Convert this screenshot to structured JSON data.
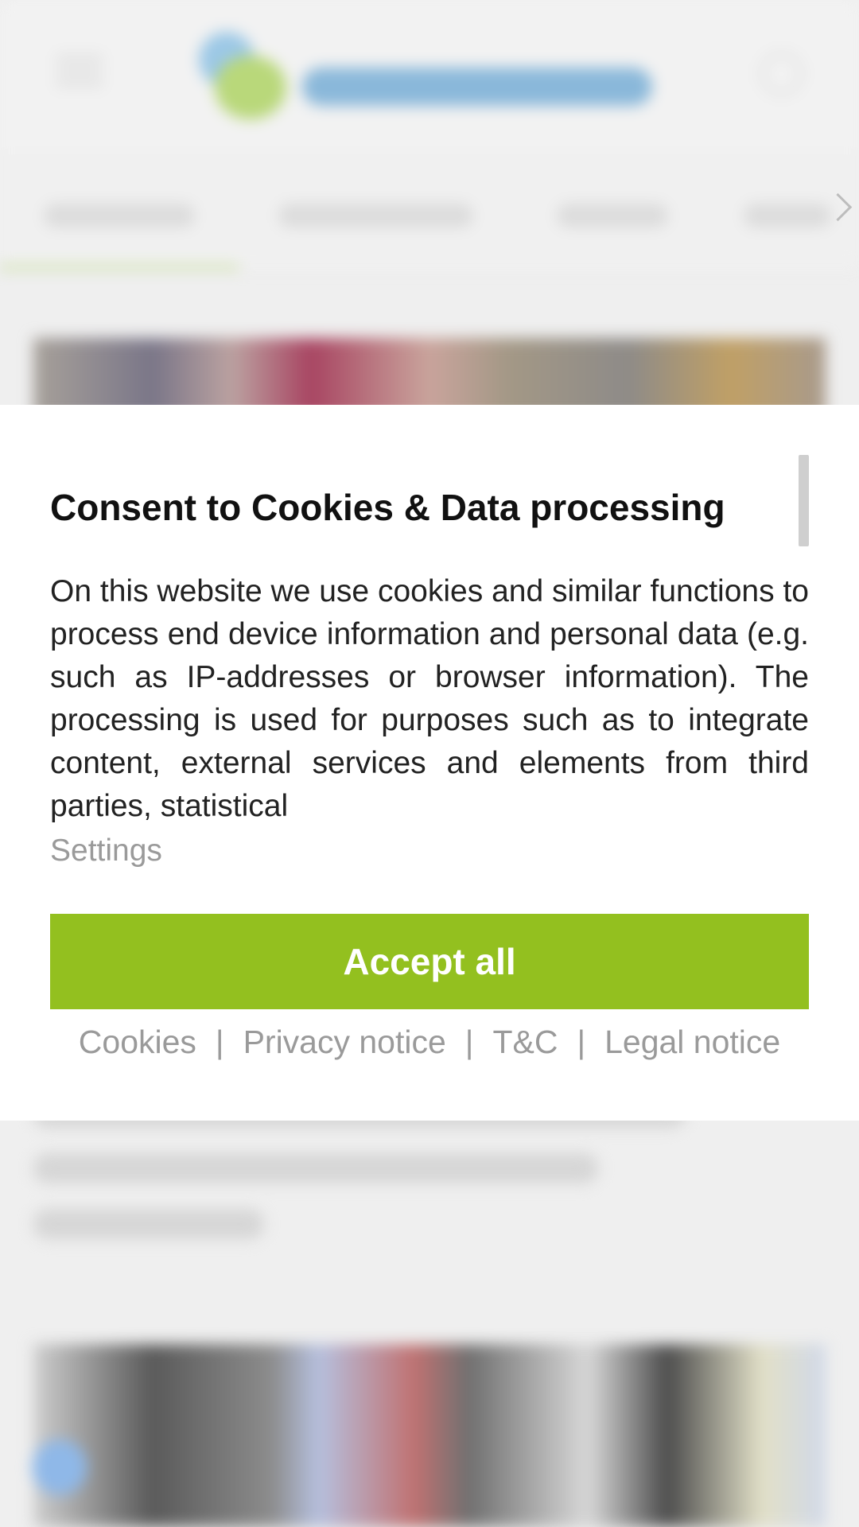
{
  "modal": {
    "title": "Consent to Cookies & Data processing",
    "body": "On this website we use cookies and similar functions to process end device information and personal data (e.g. such as IP-addresses or browser information). The processing is used for purposes such as to integrate content, external services and elements from third parties, statistical",
    "settings_label": "Settings",
    "accept_label": "Accept all",
    "links": [
      "Cookies",
      "Privacy notice",
      "T&C",
      "Legal notice"
    ],
    "separator": "|"
  },
  "colors": {
    "accent": "#93c01f",
    "muted_text": "#9a9a9a"
  },
  "icons": {
    "menu": "hamburger-icon",
    "user": "user-icon",
    "nav_next": "chevron-right-icon"
  }
}
